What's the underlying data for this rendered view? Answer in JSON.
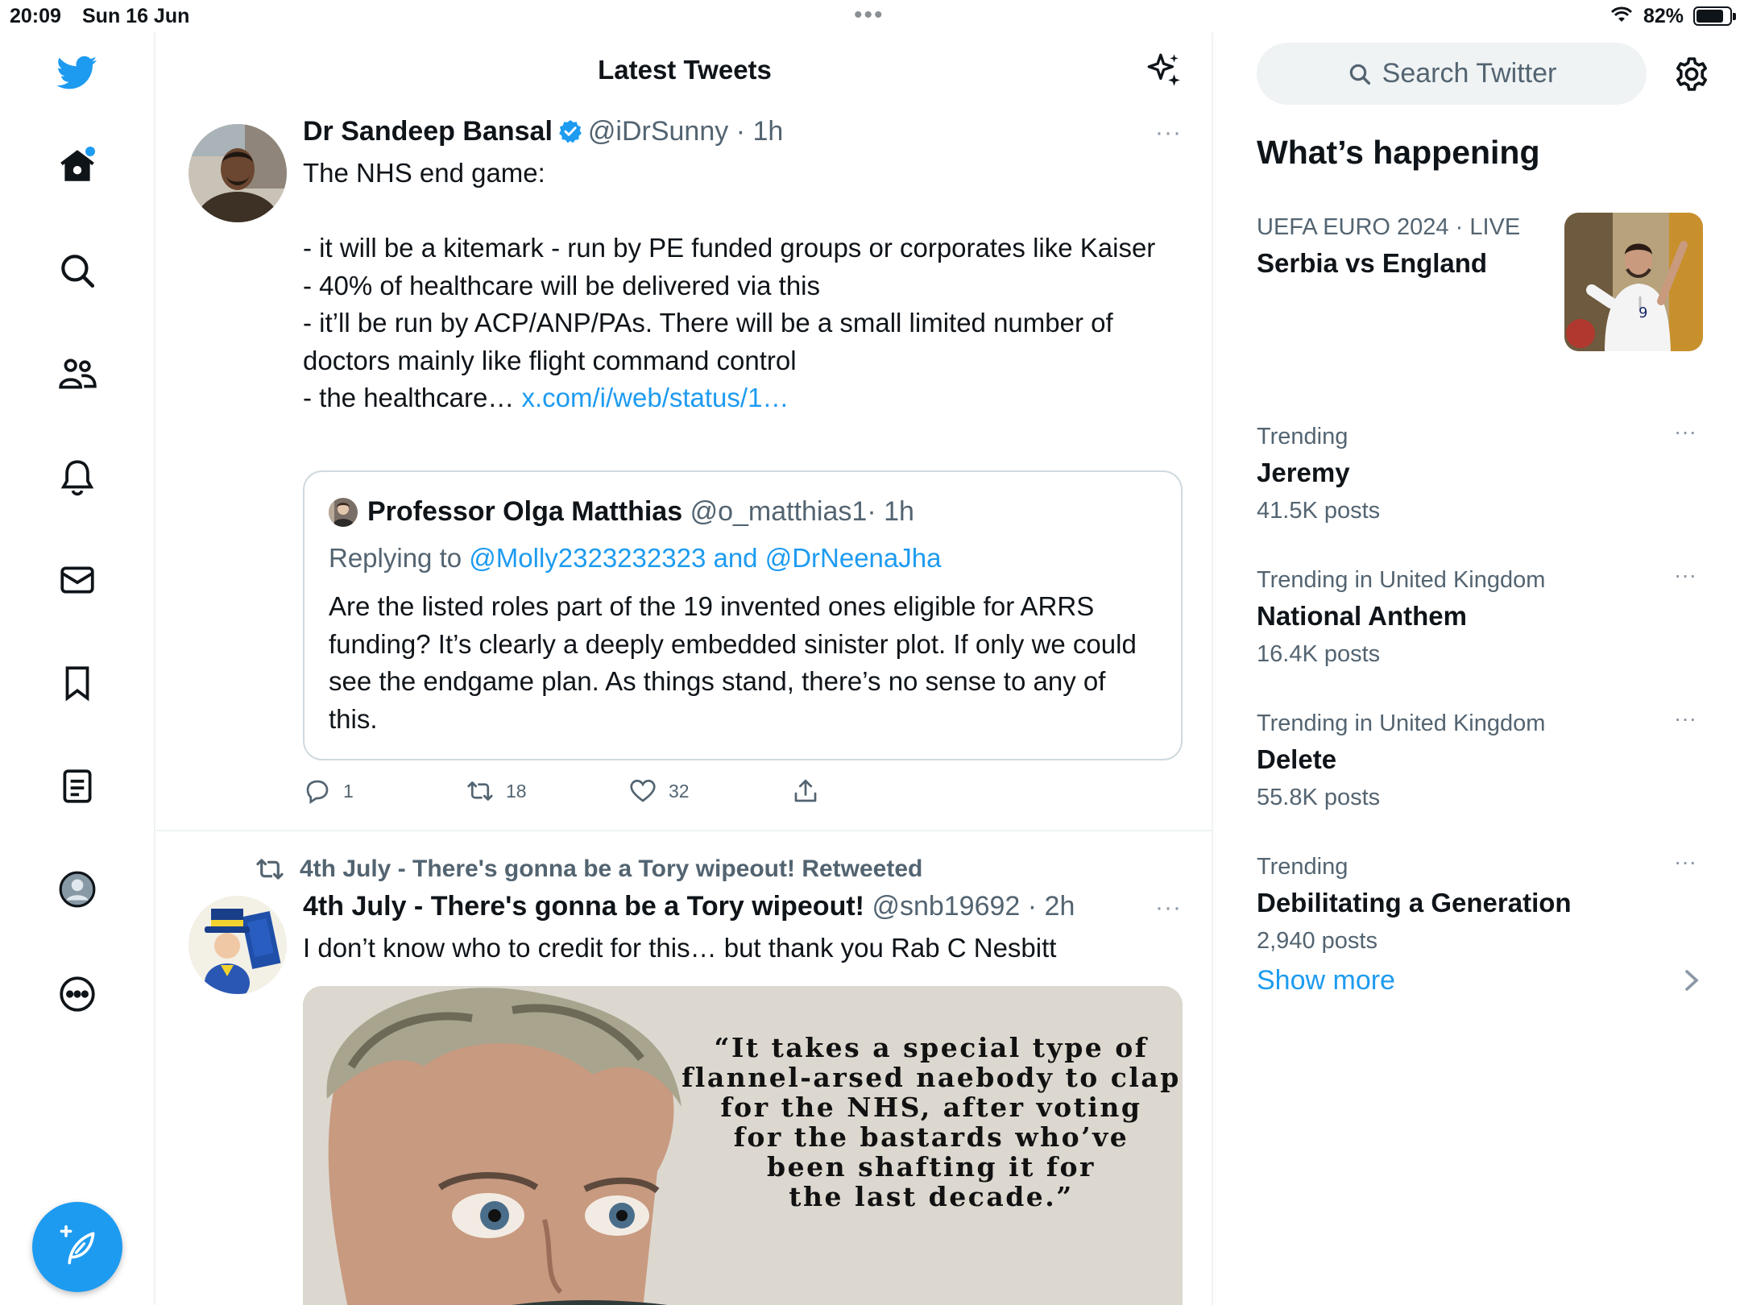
{
  "status_bar": {
    "time": "20:09",
    "date": "Sun 16 Jun",
    "dots": "•••",
    "battery_pct": "82%",
    "battery_level": 0.82
  },
  "nav": {
    "items": [
      "twitter-logo",
      "home-icon",
      "search-icon",
      "communities-icon",
      "bell-icon",
      "mail-icon",
      "bookmark-icon",
      "lists-icon",
      "profile-icon",
      "more-icon"
    ],
    "accent": "#1d9bf0"
  },
  "timeline": {
    "title": "Latest Tweets",
    "tweets": [
      {
        "name": "Dr Sandeep Bansal",
        "handle": "@iDrSunny",
        "time": "· 1h",
        "more": "···",
        "text": "The NHS end game:\n\n- it will be a kitemark - run by PE funded groups or corporates like Kaiser\n- 40% of healthcare will be delivered via this\n- it’ll be run by ACP/ANP/PAs. There will be a small limited number of doctors mainly like flight command control\n- the healthcare… ",
        "link": "x.com/i/web/status/1…",
        "quote": {
          "name": "Professor Olga Matthias",
          "handle": "@o_matthias1",
          "time": "· 1h",
          "replying_prefix": "Replying to ",
          "replying_to": "@Molly2323232323 and @DrNeenaJha",
          "text": "Are the listed roles part of the 19 invented ones eligible for ARRS funding? It’s clearly a deeply embedded sinister plot.  If only we could see the endgame plan. As things stand, there’s no sense to any of this."
        },
        "replies": "1",
        "retweets": "18",
        "likes": "32"
      },
      {
        "retweeted_by": "4th July - There's gonna be a Tory wipeout! Retweeted",
        "name": "4th July - There's gonna be a Tory wipeout!",
        "handle": "@snb19692",
        "time": "· 2h",
        "more": "···",
        "text": "I don’t know who to credit for this… but thank you Rab C Nesbitt",
        "image_quote": "“It takes a special type of\nflannel-arsed naebody to clap\nfor the NHS, after voting\nfor the bastards who’ve\nbeen shafting it for\nthe last decade.”"
      }
    ]
  },
  "sidebar": {
    "search_placeholder": "Search Twitter",
    "heading": "What’s happening",
    "trends": [
      {
        "label": "UEFA EURO 2024 · LIVE",
        "title": "Serbia vs England",
        "count": ""
      },
      {
        "label": "Trending",
        "title": "Jeremy",
        "count": "41.5K posts"
      },
      {
        "label": "Trending in United Kingdom",
        "title": "National Anthem",
        "count": "16.4K posts"
      },
      {
        "label": "Trending in United Kingdom",
        "title": "Delete",
        "count": "55.8K posts"
      },
      {
        "label": "Trending",
        "title": "Debilitating a Generation",
        "count": "2,940 posts"
      }
    ],
    "trend_more": "···",
    "show_more": "Show more"
  }
}
